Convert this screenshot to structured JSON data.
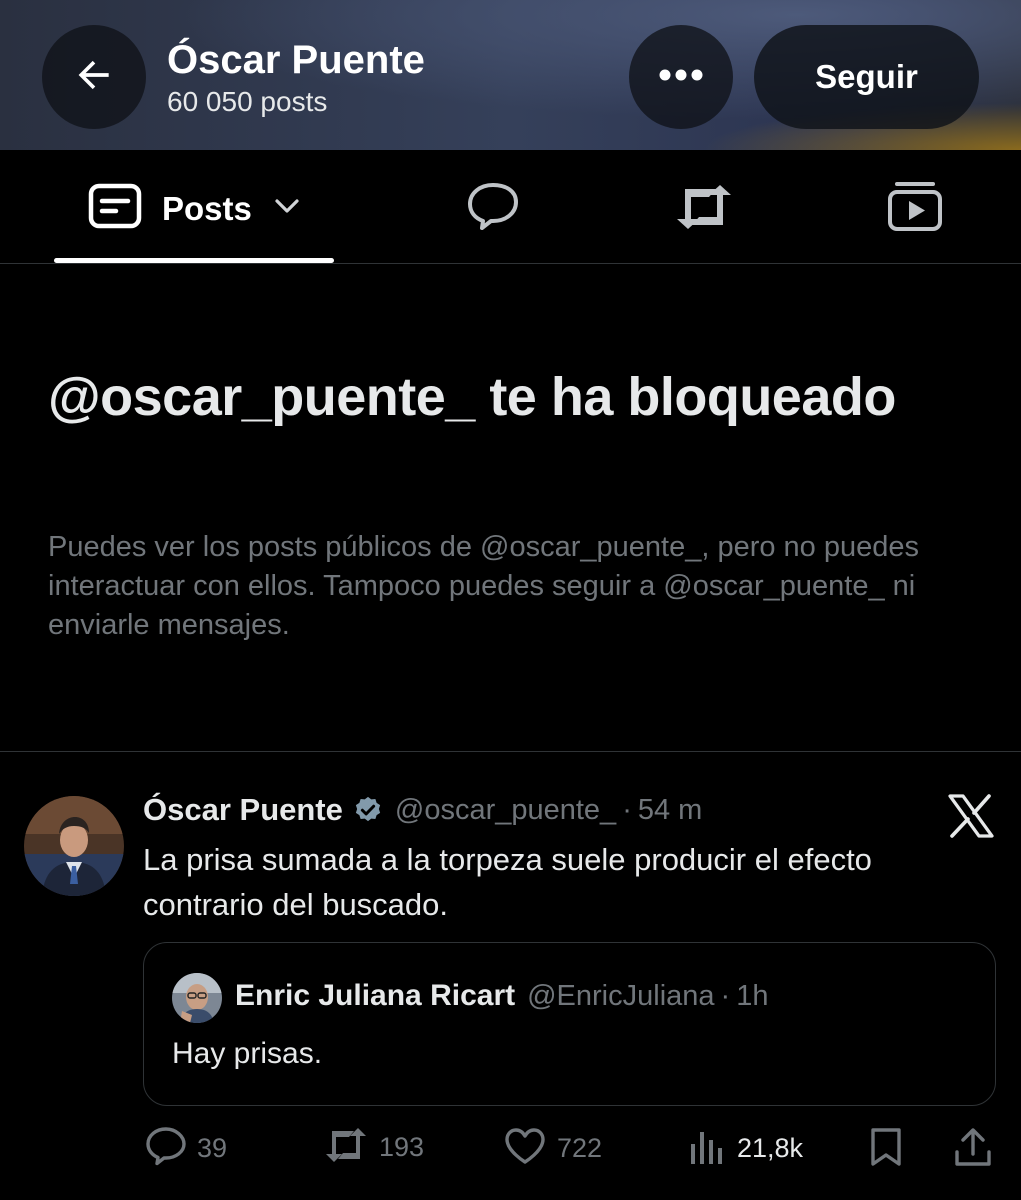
{
  "header": {
    "name": "Óscar Puente",
    "post_count": "60 050 posts",
    "follow_label": "Seguir",
    "back_icon": "arrow-left-icon",
    "more_icon": "more-horizontal-icon"
  },
  "tabs": {
    "posts_label": "Posts",
    "items": [
      "posts",
      "replies",
      "reposts",
      "media"
    ]
  },
  "blocked": {
    "title": "@oscar_puente_ te ha bloqueado",
    "description": "Puedes ver los posts públicos de @oscar_puente_, pero no puedes interactuar con ellos. Tampoco puedes seguir a @oscar_puente_ ni enviarle mensajes."
  },
  "post": {
    "author_name": "Óscar Puente",
    "handle": "@oscar_puente_",
    "dot": "·",
    "time": "54 m",
    "text": "La prisa sumada a la torpeza suele producir el efecto contrario del buscado.",
    "quote": {
      "author_name": "Enric Juliana Ricart",
      "handle": "@EnricJuliana",
      "dot": "·",
      "time": "1h",
      "text": "Hay prisas."
    },
    "actions": {
      "replies": "39",
      "reposts": "193",
      "likes": "722",
      "views": "21,8k"
    }
  },
  "colors": {
    "background": "#000000",
    "text_primary": "#e7e9ea",
    "text_secondary": "#71767b",
    "border": "#2f3336",
    "verified": "#829aab"
  }
}
